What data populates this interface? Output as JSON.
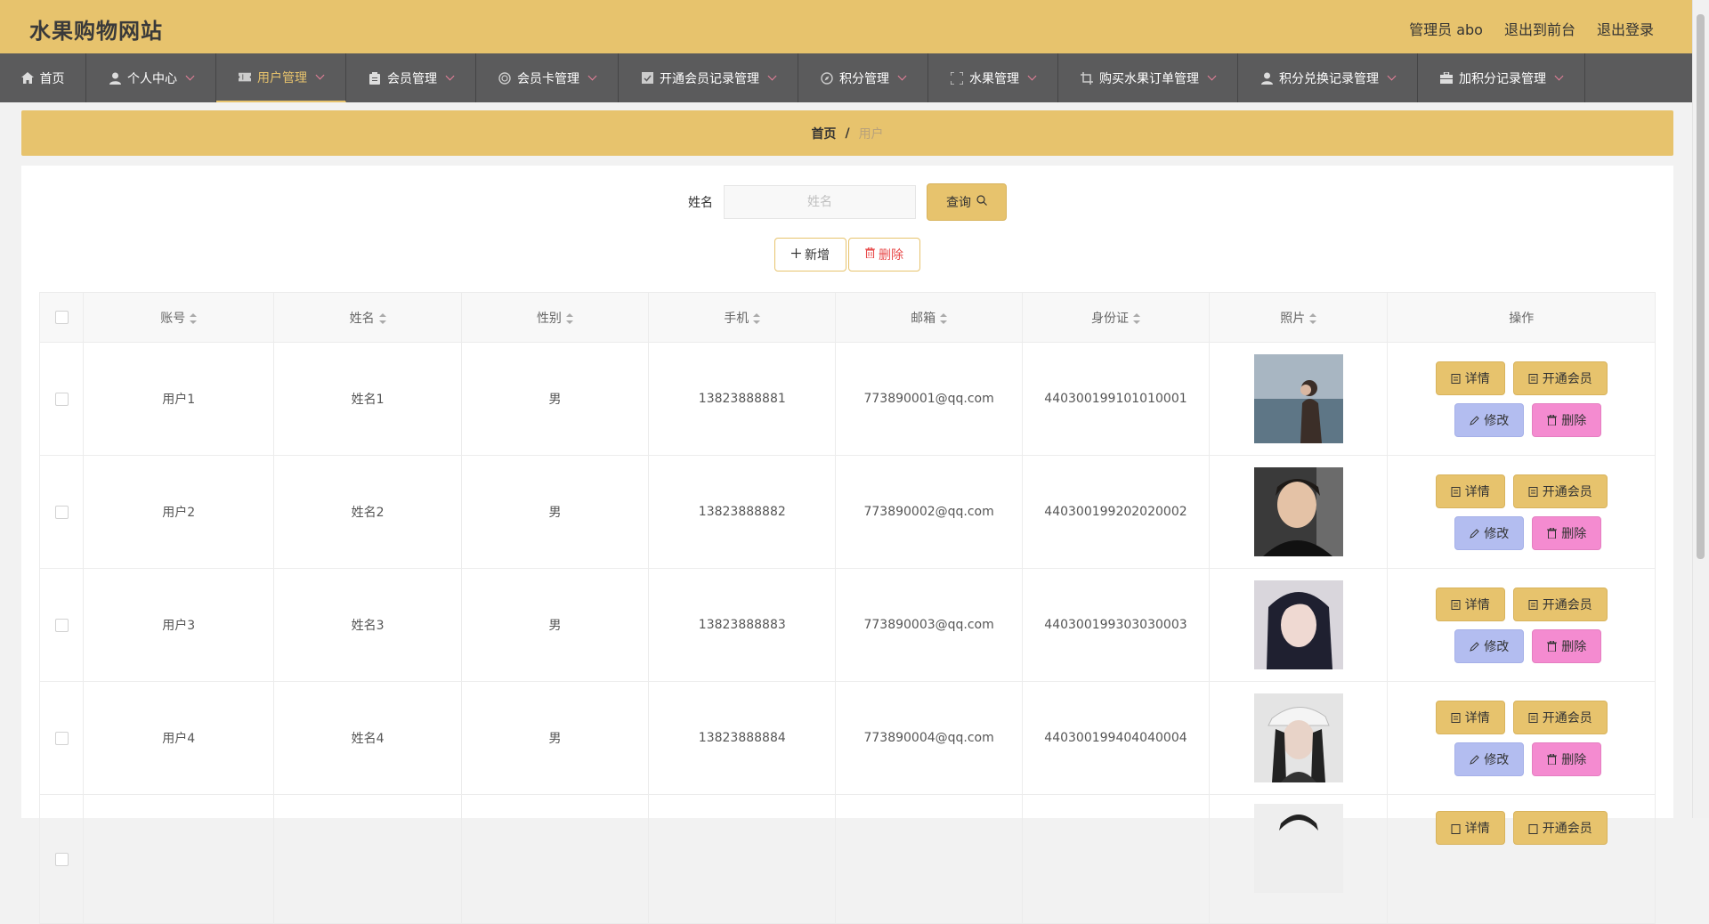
{
  "header": {
    "site_title": "水果购物网站",
    "admin_label": "管理员 abo",
    "to_front": "退出到前台",
    "logout": "退出登录"
  },
  "nav": {
    "items": [
      {
        "label": "首页",
        "icon": "home-icon"
      },
      {
        "label": "个人中心",
        "icon": "person-icon"
      },
      {
        "label": "用户管理",
        "icon": "ticket-icon",
        "active": true
      },
      {
        "label": "会员管理",
        "icon": "clipboard-icon"
      },
      {
        "label": "会员卡管理",
        "icon": "card-icon"
      },
      {
        "label": "开通会员记录管理",
        "icon": "checklist-icon"
      },
      {
        "label": "积分管理",
        "icon": "compass-icon"
      },
      {
        "label": "水果管理",
        "icon": "frame-icon"
      },
      {
        "label": "购买水果订单管理",
        "icon": "crop-icon"
      },
      {
        "label": "积分兑换记录管理",
        "icon": "person-icon"
      },
      {
        "label": "加积分记录管理",
        "icon": "briefcase-icon"
      }
    ]
  },
  "breadcrumb": {
    "home": "首页",
    "separator": "/",
    "current": "用户"
  },
  "search": {
    "label": "姓名",
    "placeholder": "姓名",
    "value": "",
    "query_label": "查询"
  },
  "actions": {
    "add_label": "新增",
    "delete_label": "删除"
  },
  "table": {
    "columns": [
      "账号",
      "姓名",
      "性别",
      "手机",
      "邮箱",
      "身份证",
      "照片",
      "操作"
    ],
    "rows": [
      {
        "account": "用户1",
        "name": "姓名1",
        "gender": "男",
        "phone": "13823888881",
        "email": "773890001@qq.com",
        "id_card": "440300199101010001"
      },
      {
        "account": "用户2",
        "name": "姓名2",
        "gender": "男",
        "phone": "13823888882",
        "email": "773890002@qq.com",
        "id_card": "440300199202020002"
      },
      {
        "account": "用户3",
        "name": "姓名3",
        "gender": "男",
        "phone": "13823888883",
        "email": "773890003@qq.com",
        "id_card": "440300199303030003"
      },
      {
        "account": "用户4",
        "name": "姓名4",
        "gender": "男",
        "phone": "13823888884",
        "email": "773890004@qq.com",
        "id_card": "440300199404040004"
      },
      {
        "account": "",
        "name": "",
        "gender": "",
        "phone": "",
        "email": "",
        "id_card": ""
      }
    ],
    "ops": {
      "detail": "详情",
      "member": "开通会员",
      "edit": "修改",
      "delete": "删除"
    }
  },
  "colors": {
    "accent": "#e7c36d",
    "nav_bg": "#5b5b5c",
    "edit_btn": "#b3bdf0",
    "delete_btn": "#f48bd0",
    "delete_text": "#e84a4a"
  }
}
